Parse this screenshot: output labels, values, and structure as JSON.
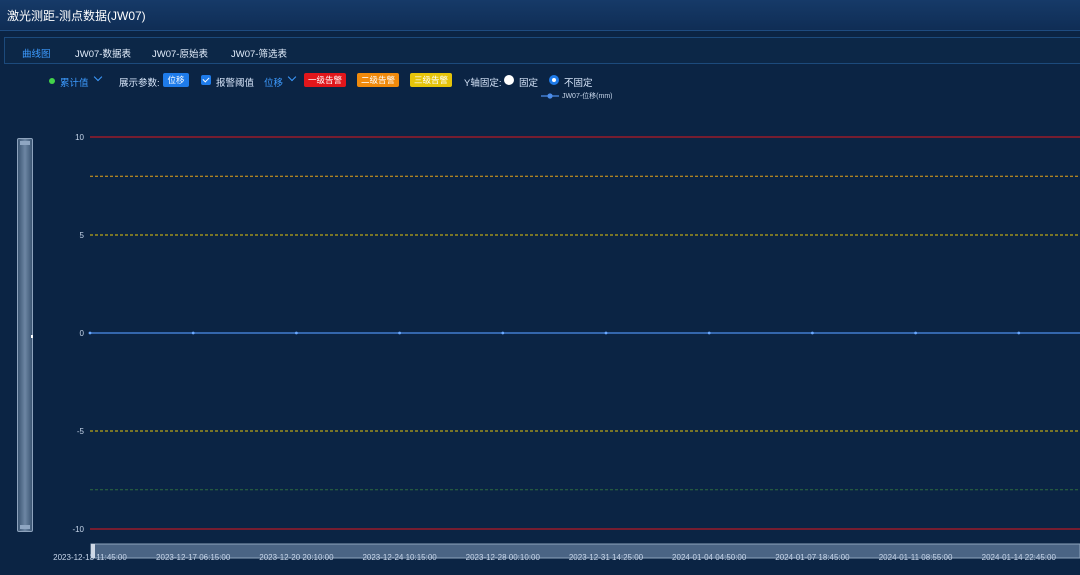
{
  "window": {
    "title": "激光测距-测点数据(JW07)"
  },
  "tabs": [
    {
      "label": "曲线图",
      "active": true
    },
    {
      "label": "JW07-数据表",
      "active": false
    },
    {
      "label": "JW07-原始表",
      "active": false
    },
    {
      "label": "JW07-筛选表",
      "active": false
    }
  ],
  "toolbar": {
    "mode_label": "累计值",
    "display_params_label": "展示参数:",
    "display_param_value": "位移",
    "alarm_threshold_label": "报警阈值",
    "alarm_threshold_checked": true,
    "threshold_type": "位移",
    "level1": "一级告警",
    "level2": "二级告警",
    "level3": "三级告警",
    "y_axis_fixed_label": "Y轴固定:",
    "fixed_option": "固定",
    "not_fixed_option": "不固定",
    "y_axis_fixed": false
  },
  "colors": {
    "level1": "#e1161b",
    "level2": "#f08a0c",
    "level3": "#e6c40a",
    "series": "#4c8dea",
    "accent": "#3d9bff"
  },
  "chart_data": {
    "type": "line",
    "series": [
      {
        "name": "JW07-位移(mm)",
        "x": [
          "2023-12-13 11:45:00",
          "2023-12-17 06:15:00",
          "2023-12-20 20:10:00",
          "2023-12-24 10:15:00",
          "2023-12-28 00:10:00",
          "2023-12-31 14:25:00",
          "2024-01-04 04:50:00",
          "2024-01-07 18:45:00",
          "2024-01-11 08:55:00",
          "2024-01-14 22:45:00"
        ],
        "values": [
          0,
          0,
          0,
          0,
          0,
          0,
          0,
          0,
          0,
          0
        ]
      }
    ],
    "y_ticks": [
      10,
      5,
      0,
      -5,
      -10
    ],
    "x_tick_labels": [
      "2023-12-13 11:45:00",
      "2023-12-17 06:15:00",
      "2023-12-20 20:10:00",
      "2023-12-24 10:15:00",
      "2023-12-28 00:10:00",
      "2023-12-31 14:25:00",
      "2024-01-04 04:50:00",
      "2024-01-07 18:45:00",
      "2024-01-11 08:55:00",
      "2024-01-14 22:45:00"
    ],
    "ylim": [
      -10,
      10
    ],
    "threshold_lines": [
      {
        "value": 10,
        "color": "#e1161b",
        "style": "solid"
      },
      {
        "value": 8,
        "color": "#e6a417",
        "style": "dashed"
      },
      {
        "value": 5,
        "color": "#e6c40a",
        "style": "dashed"
      },
      {
        "value": -5,
        "color": "#e6c40a",
        "style": "dashed"
      },
      {
        "value": -8,
        "color": "#2f6b3e",
        "style": "dashed"
      },
      {
        "value": -10,
        "color": "#e1161b",
        "style": "solid"
      }
    ],
    "legend_position": "top-center"
  }
}
